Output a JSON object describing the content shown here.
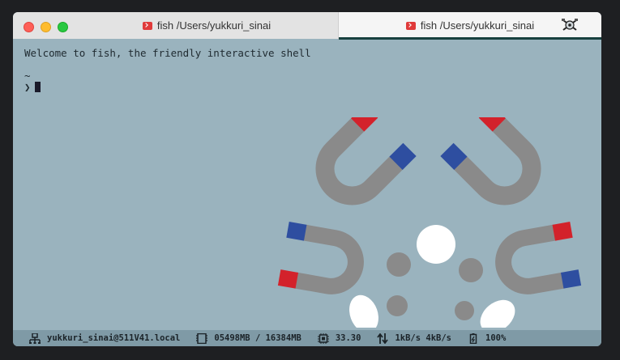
{
  "tabs": [
    {
      "label": "fish /Users/yukkuri_sinai",
      "active": false
    },
    {
      "label": "fish /Users/yukkuri_sinai",
      "active": true
    }
  ],
  "terminal": {
    "welcome": "Welcome to fish, the friendly interactive shell",
    "cwd": "~",
    "prompt": "❯"
  },
  "statusbar": {
    "host": "yukkuri_sinai@511V41.local",
    "memory": "05498MB / 16384MB",
    "cpu": "33.30",
    "network": "1kB/s 4kB/s",
    "battery": "100%"
  },
  "colors": {
    "terminal_bg": "#9ab3be",
    "statusbar_bg": "#7f9aa6",
    "magnet_red": "#d3222b",
    "magnet_blue": "#2e4ea0",
    "magnet_gray": "#8a8a8a"
  }
}
